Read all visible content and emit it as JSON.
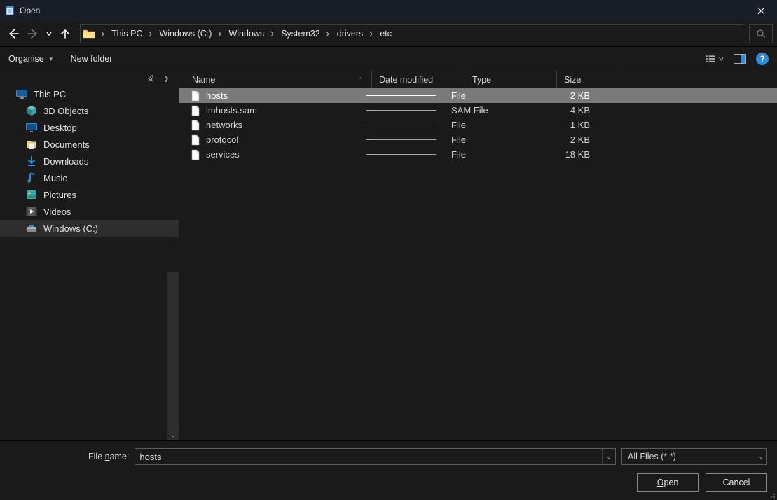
{
  "title": "Open",
  "breadcrumb": {
    "items": [
      "This PC",
      "Windows (C:)",
      "Windows",
      "System32",
      "drivers",
      "etc"
    ]
  },
  "toolbar": {
    "organise": "Organise",
    "new_folder": "New folder"
  },
  "sidebar": {
    "items": [
      {
        "label": "This PC",
        "icon": "monitor",
        "level": 1,
        "selected": false
      },
      {
        "label": "3D Objects",
        "icon": "cube",
        "level": 2,
        "selected": false
      },
      {
        "label": "Desktop",
        "icon": "desktop",
        "level": 2,
        "selected": false
      },
      {
        "label": "Documents",
        "icon": "document-folder",
        "level": 2,
        "selected": false
      },
      {
        "label": "Downloads",
        "icon": "download",
        "level": 2,
        "selected": false
      },
      {
        "label": "Music",
        "icon": "music",
        "level": 2,
        "selected": false
      },
      {
        "label": "Pictures",
        "icon": "picture",
        "level": 2,
        "selected": false
      },
      {
        "label": "Videos",
        "icon": "video",
        "level": 2,
        "selected": false
      },
      {
        "label": "Windows (C:)",
        "icon": "drive",
        "level": 2,
        "selected": true
      }
    ]
  },
  "columns": {
    "name": "Name",
    "date": "Date modified",
    "type": "Type",
    "size": "Size"
  },
  "files": [
    {
      "name": "hosts",
      "type": "File",
      "size": "2 KB",
      "selected": true
    },
    {
      "name": "lmhosts.sam",
      "type": "SAM File",
      "size": "4 KB",
      "selected": false
    },
    {
      "name": "networks",
      "type": "File",
      "size": "1 KB",
      "selected": false
    },
    {
      "name": "protocol",
      "type": "File",
      "size": "2 KB",
      "selected": false
    },
    {
      "name": "services",
      "type": "File",
      "size": "18 KB",
      "selected": false
    }
  ],
  "filename": {
    "label_pre": "File ",
    "label_u": "n",
    "label_post": "ame:",
    "value": "hosts"
  },
  "filter": {
    "selected": "All Files  (*.*)"
  },
  "buttons": {
    "open_u": "O",
    "open_rest": "pen",
    "cancel": "Cancel"
  }
}
